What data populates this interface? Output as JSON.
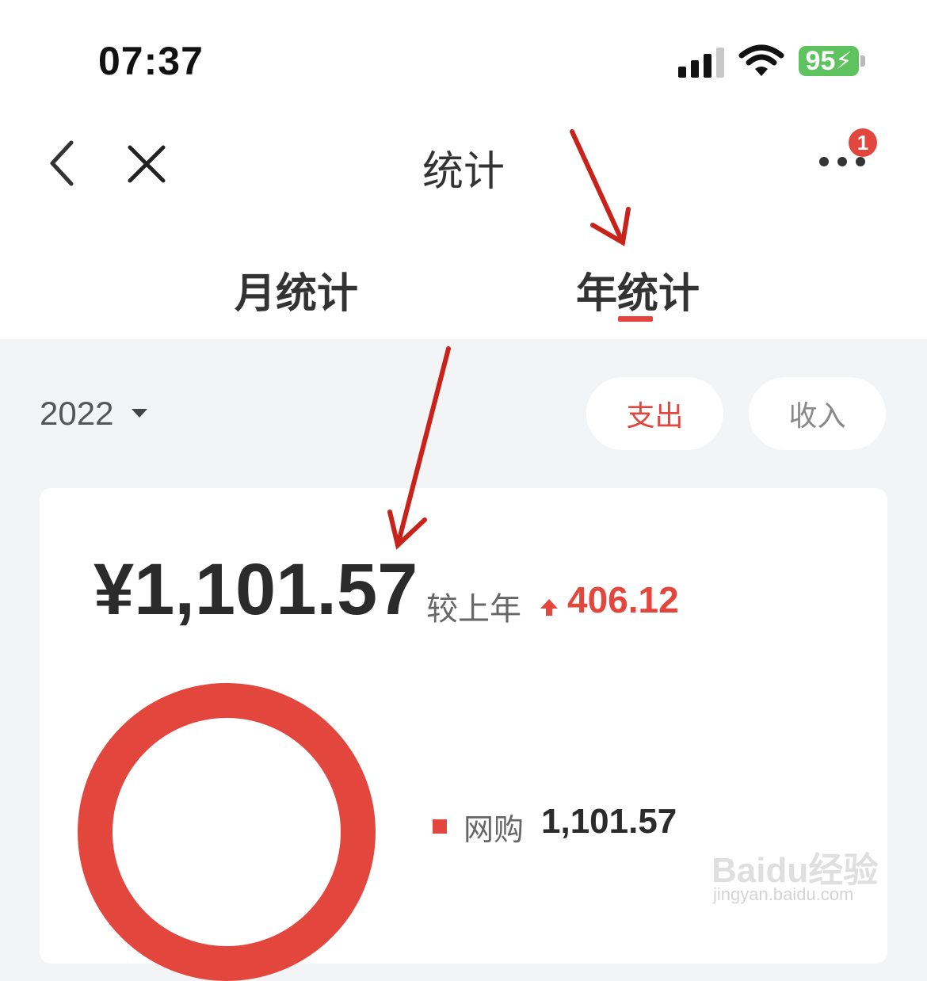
{
  "status_bar": {
    "time": "07:37",
    "battery": "95"
  },
  "nav": {
    "title": "统计",
    "badge": "1"
  },
  "tabs": [
    {
      "label": "月统计",
      "active": false
    },
    {
      "label": "年统计",
      "active": true
    }
  ],
  "filter": {
    "year": "2022",
    "type_options": [
      "支出",
      "收入"
    ],
    "selected": "支出"
  },
  "summary": {
    "total": "¥1,101.57",
    "compare_label": "较上年",
    "compare_value": "406.12",
    "trend": "up"
  },
  "categories": [
    {
      "name": "网购",
      "value": "1,101.57",
      "share": 1.0,
      "color": "#e2463d"
    }
  ],
  "watermark": {
    "main": "Baidu经验",
    "sub": "jingyan.baidu.com"
  },
  "colors": {
    "accent": "#e2463d",
    "background": "#f3f4f6"
  }
}
